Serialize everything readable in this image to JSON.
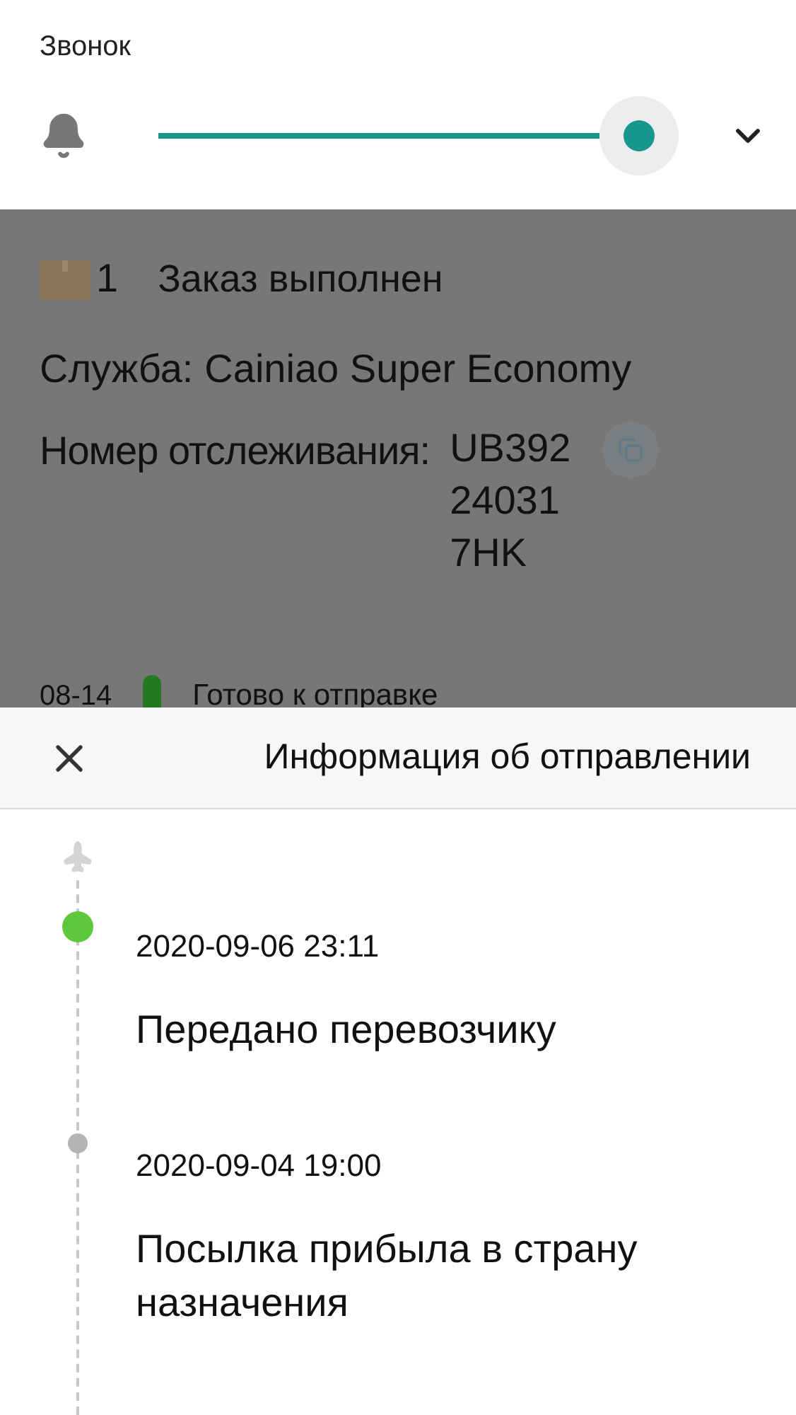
{
  "volume_panel": {
    "title": "Звонок"
  },
  "order": {
    "count": "1",
    "status": "Заказ выполнен",
    "service_label": "Служба:",
    "service_value": "Cainiao Super Economy",
    "tracking_label": "Номер отслеживания:",
    "tracking_lines": [
      "UB392",
      "24031",
      "7HK"
    ],
    "latest_event": {
      "date": "08-14",
      "status": "Готово к отправке"
    }
  },
  "sheet": {
    "title": "Информация об отправлении",
    "events": [
      {
        "time": "2020-09-06 23:11",
        "description": "Передано перевозчику",
        "current": true
      },
      {
        "time": "2020-09-04 19:00",
        "description": "Посылка прибыла в страну назначения",
        "current": false
      }
    ]
  }
}
